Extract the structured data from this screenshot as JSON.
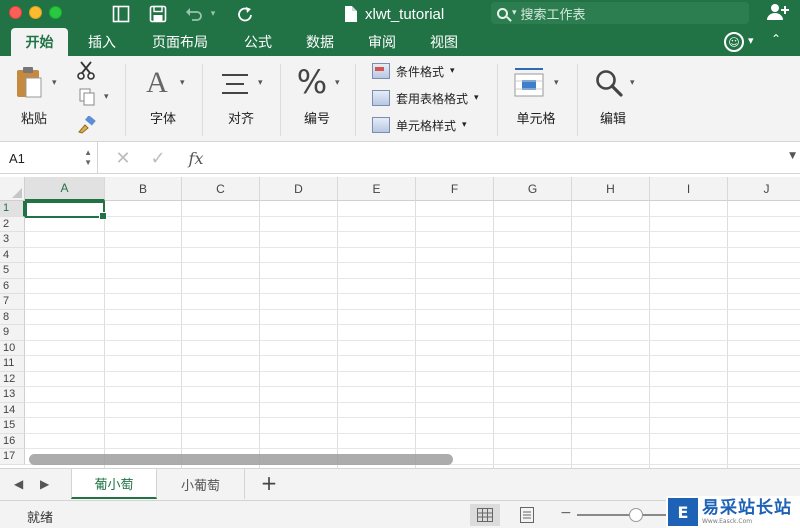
{
  "window": {
    "title": "xlwt_tutorial",
    "search_placeholder": "搜索工作表"
  },
  "ribbon_tabs": [
    "开始",
    "插入",
    "页面布局",
    "公式",
    "数据",
    "审阅",
    "视图"
  ],
  "ribbon": {
    "clipboard": {
      "paste_label": "粘贴"
    },
    "font_label": "字体",
    "align_label": "对齐",
    "number_label": "编号",
    "styles": {
      "conditional_format": "条件格式",
      "format_as_table": "套用表格格式",
      "cell_styles": "单元格样式"
    },
    "cells_label": "单元格",
    "edit_label": "编辑"
  },
  "formula_bar": {
    "name_box": "A1",
    "formula": ""
  },
  "grid": {
    "columns": [
      "A",
      "B",
      "C",
      "D",
      "E",
      "F",
      "G",
      "H",
      "I",
      "J"
    ],
    "rows": [
      "1",
      "2",
      "3",
      "4",
      "5",
      "6",
      "7",
      "8",
      "9",
      "10",
      "11",
      "12",
      "13",
      "14",
      "15",
      "16",
      "17"
    ],
    "selected_cell": "A1"
  },
  "sheets": [
    "葡小萄",
    "小葡萄"
  ],
  "active_sheet": "葡小萄",
  "status": {
    "text": "就绪"
  },
  "watermark": {
    "text": "易采站长站",
    "sub": "Www.Easck.Com"
  },
  "colors": {
    "accent": "#217346",
    "ribbon_bg": "#f3f3f3"
  }
}
